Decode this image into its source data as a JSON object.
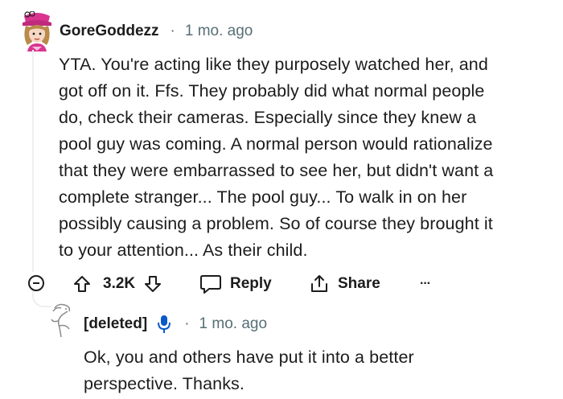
{
  "comment": {
    "author": "GoreGoddezz",
    "separator": "·",
    "time": "1 mo. ago",
    "body_lines": [
      "YTA. You're acting like they purposely watched her, and",
      "got off on it. Ffs. They probably did what normal people",
      "do, check their cameras. Especially since they knew a",
      "pool guy was coming. A normal person would rationalize",
      "that they were embarrassed to see her, but didn't want a",
      "complete stranger... The pool guy... To walk in on her",
      "possibly causing a problem. So of course they brought it",
      "to your attention... As their child."
    ],
    "actions": {
      "score": "3.2K",
      "reply_label": "Reply",
      "share_label": "Share",
      "more_label": "···"
    },
    "icons": [
      "avatar",
      "collapse-icon",
      "upvote-icon",
      "downvote-icon",
      "reply-icon",
      "share-icon",
      "more-icon"
    ]
  },
  "reply": {
    "author": "[deleted]",
    "separator": "·",
    "time": "1 mo. ago",
    "body_lines": [
      "Ok, you and others have put it into a better",
      "perspective. Thanks."
    ],
    "icons": [
      "deleted-avatar",
      "microphone-icon"
    ]
  },
  "colors": {
    "text": "#1c1c1c",
    "meta": "#576f76",
    "avatar_pink": "#d9358f",
    "mic_blue": "#0a59c9",
    "thread_line": "#edeff1"
  }
}
